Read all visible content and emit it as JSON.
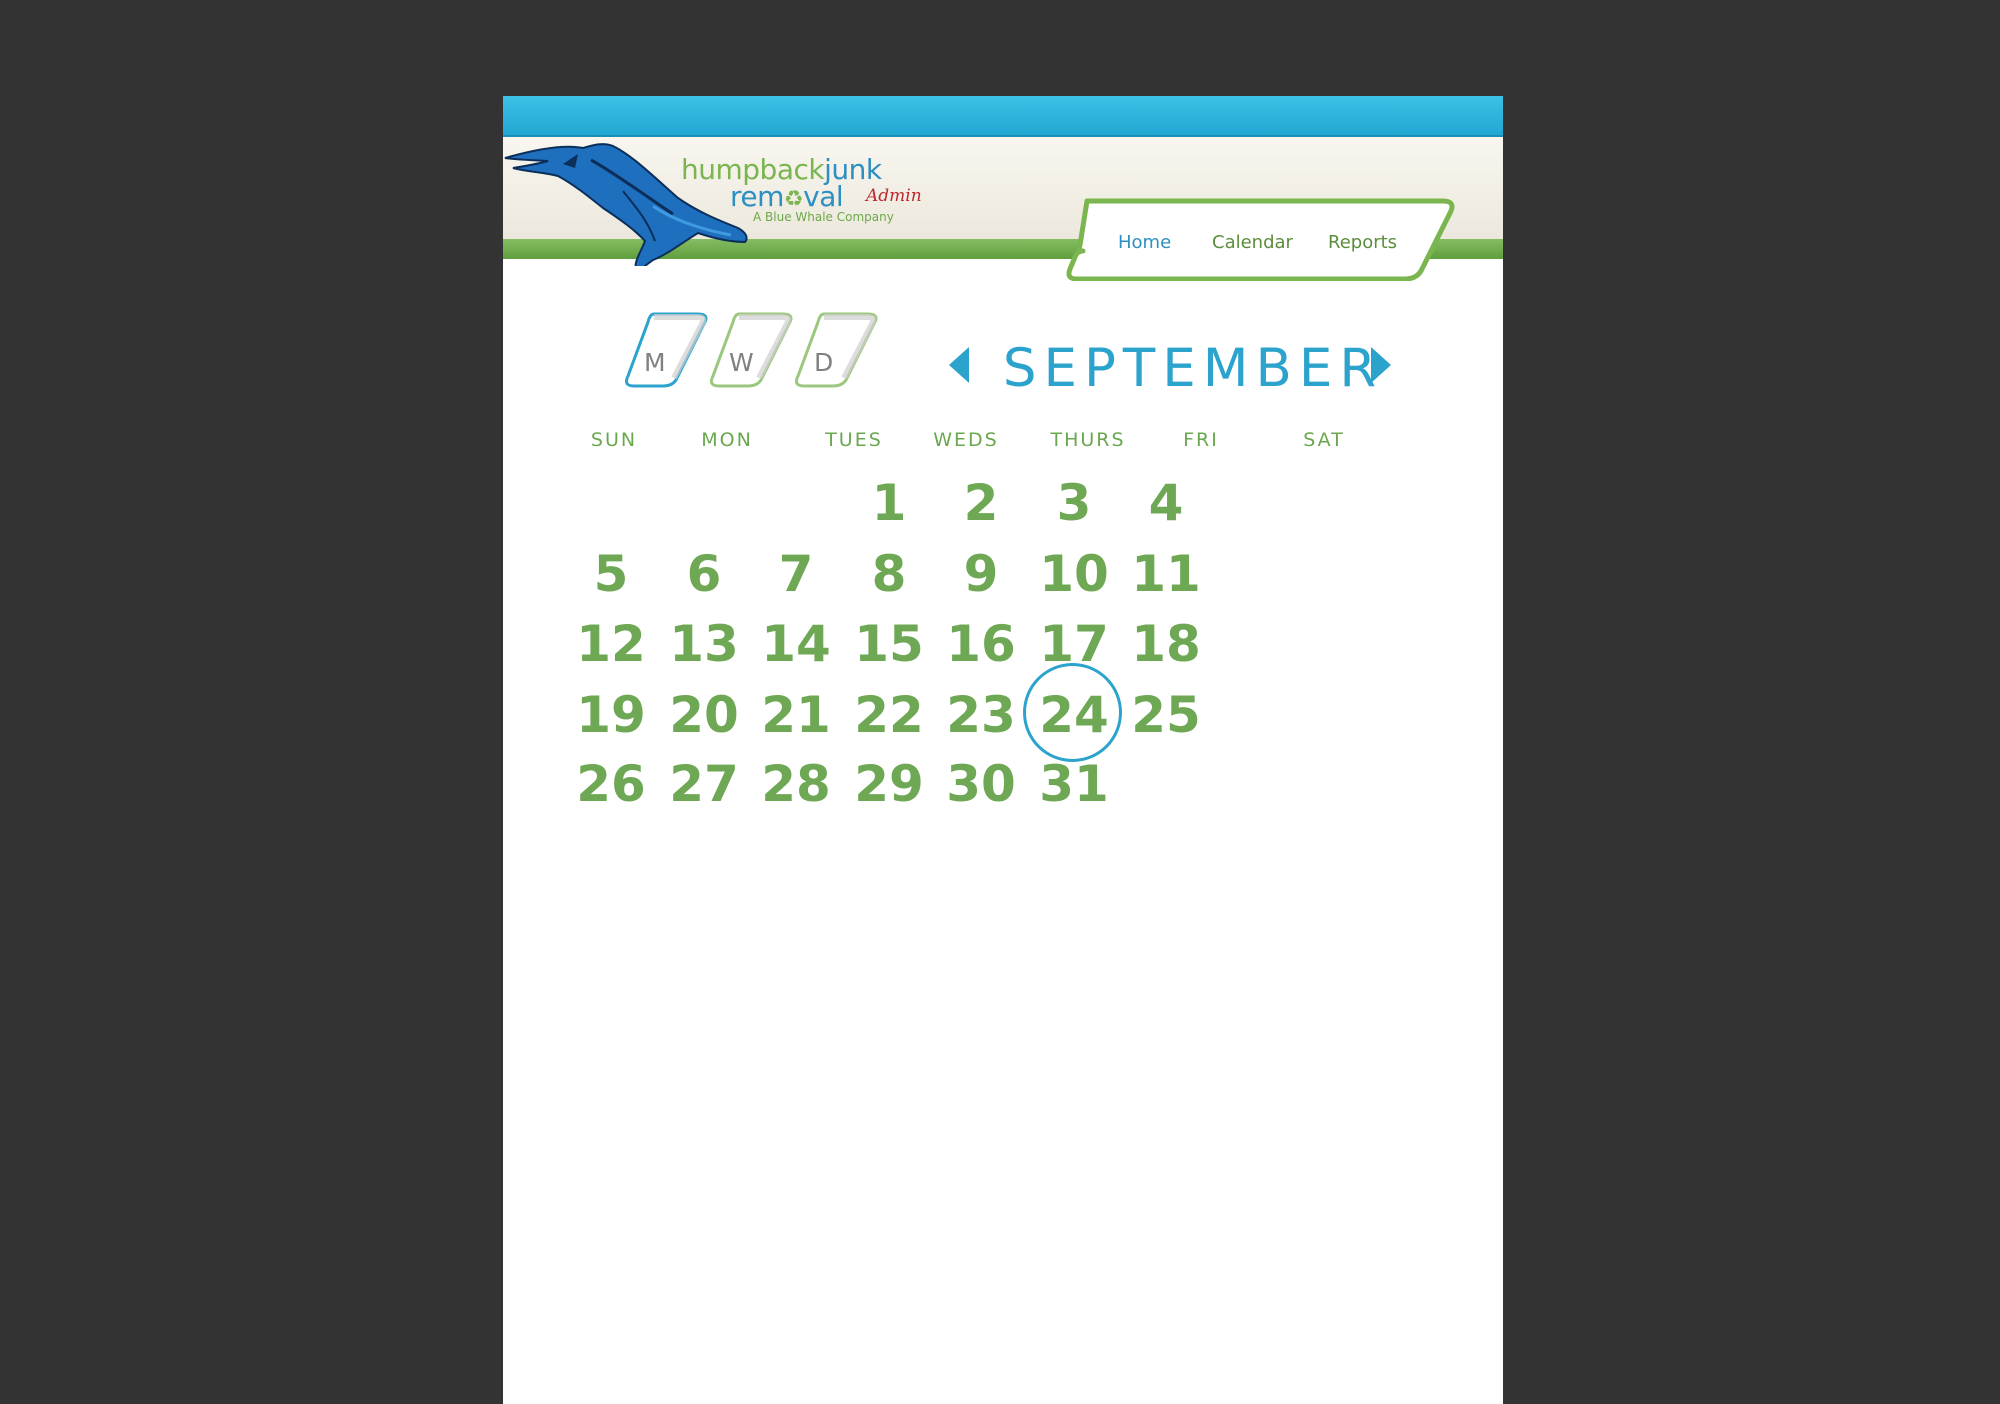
{
  "brand": {
    "line1_a": "humpback",
    "line1_b": "junk",
    "line2_a": "rem",
    "line2_icon": "recycle-icon",
    "line2_b": "val",
    "admin": "Admin",
    "tagline": "A Blue Whale Company",
    "mascot_icon": "humpback-whale-icon"
  },
  "nav": {
    "items": [
      {
        "label": "Home",
        "active": true
      },
      {
        "label": "Calendar",
        "active": false
      },
      {
        "label": "Reports",
        "active": false
      }
    ]
  },
  "view_switcher": {
    "buttons": [
      {
        "label": "M",
        "selected": true
      },
      {
        "label": "W",
        "selected": false
      },
      {
        "label": "D",
        "selected": false
      }
    ]
  },
  "calendar": {
    "month": "SEPTEMBER",
    "prev_icon": "caret-left-icon",
    "next_icon": "caret-right-icon",
    "weekdays": [
      "SUN",
      "MON",
      "TUES",
      "WEDS",
      "THURS",
      "FRI",
      "SAT"
    ],
    "first_weekday": 3,
    "days_in_month": 31,
    "today": 24
  },
  "colors": {
    "background": "#333333",
    "page": "#ffffff",
    "blue_accent": "#2ba3cc",
    "green_accent": "#6ea854",
    "admin_red": "#c0272d"
  }
}
